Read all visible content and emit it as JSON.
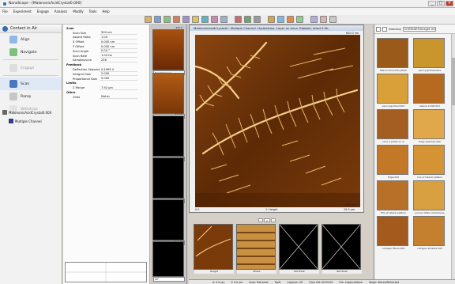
{
  "window": {
    "title": "NanoScope - [MalononicAcidCrystal0.000]"
  },
  "menu": [
    "File",
    "Experiment",
    "Engage",
    "Analysis",
    "Modify",
    "Tools",
    "Help"
  ],
  "nav": {
    "header": "Contact in Air",
    "items": [
      {
        "label": "Align",
        "enabled": true
      },
      {
        "label": "Navigate",
        "enabled": true
      },
      {
        "label": "Engage",
        "enabled": false
      },
      {
        "label": "Scan",
        "enabled": true
      },
      {
        "label": "Ramp",
        "enabled": true
      },
      {
        "label": "Withdraw",
        "enabled": false
      }
    ],
    "experiment": "MalononicAcidCrystal0.000",
    "channel_node": "Multiple Channel"
  },
  "params": [
    {
      "k": "Scan",
      "v": "",
      "group": true
    },
    {
      "k": "Scan Size",
      "v": "500 nm"
    },
    {
      "k": "Aspect Ratio",
      "v": "1.00"
    },
    {
      "k": "X Offset",
      "v": "0.000 nm"
    },
    {
      "k": "Y Offset",
      "v": "0.000 nm"
    },
    {
      "k": "Scan Angle",
      "v": "0.00 °"
    },
    {
      "k": "Scan Rate",
      "v": "1.00 Hz"
    },
    {
      "k": "Samples/Line",
      "v": "256"
    },
    {
      "k": "Feedback",
      "v": "",
      "group": true
    },
    {
      "k": "Deflection Setpoint",
      "v": "0.4999 V"
    },
    {
      "k": "Integral Gain",
      "v": "2.000"
    },
    {
      "k": "Proportional Gain",
      "v": "5.000"
    },
    {
      "k": "Limits",
      "v": "",
      "group": true
    },
    {
      "k": "Z Range",
      "v": "7.92 µm"
    },
    {
      "k": "Other",
      "v": "",
      "group": true
    },
    {
      "k": "Units",
      "v": "Metric"
    }
  ],
  "channels": [
    {
      "caption": "Height Sensor",
      "num": "397.5",
      "active": true
    },
    {
      "caption": "Deflection Error",
      "num": "",
      "active": true
    },
    {
      "caption": "Off",
      "num": "1.0 nA",
      "active": false
    },
    {
      "caption": "Off",
      "num": "1.0 nA",
      "active": false
    },
    {
      "caption": "Off",
      "num": "1.0 nA",
      "active": false
    },
    {
      "caption": "Off",
      "num": "1.0 nA",
      "active": false
    }
  ],
  "image": {
    "title": "MalononicAcidCrystal0 : Multiple Channel -Hydrolisine, Layer on mica. Rubbed, dried 0.5h-",
    "zmax": "800.0 nm",
    "zmin": "0.0 nm",
    "xmin": "0.0",
    "xmax": "10.0 µm",
    "caption": "1: Height",
    "page": "1"
  },
  "thumbs": [
    "Height",
    "Phase",
    "Not Exist",
    "Not Exist"
  ],
  "status": [
    "X: 0.0 µm",
    "Y: 0.0 µm",
    "Scan: Retraced",
    "Tip/R",
    "Capture: Off",
    "Time left: 00:00:00",
    "File: Capture/None",
    "Stage: Stereo/Retracted"
  ],
  "gallery": {
    "filter_label": "Directory",
    "path": "D:\\IMAGES\\Images mica",
    "tiles": [
      "MalononicAcidCrystal0",
      "percrysp/dried.001",
      "percrysp/dried.003",
      "alkane.4.004.001",
      "juice crystals on m",
      "fidge.selected.000",
      "fidge.000",
      "mix of lateral pattern",
      "film of lateral pattern",
      "porous teflon membrane",
      "collagen fibers.000",
      "collagen striated.000"
    ]
  }
}
